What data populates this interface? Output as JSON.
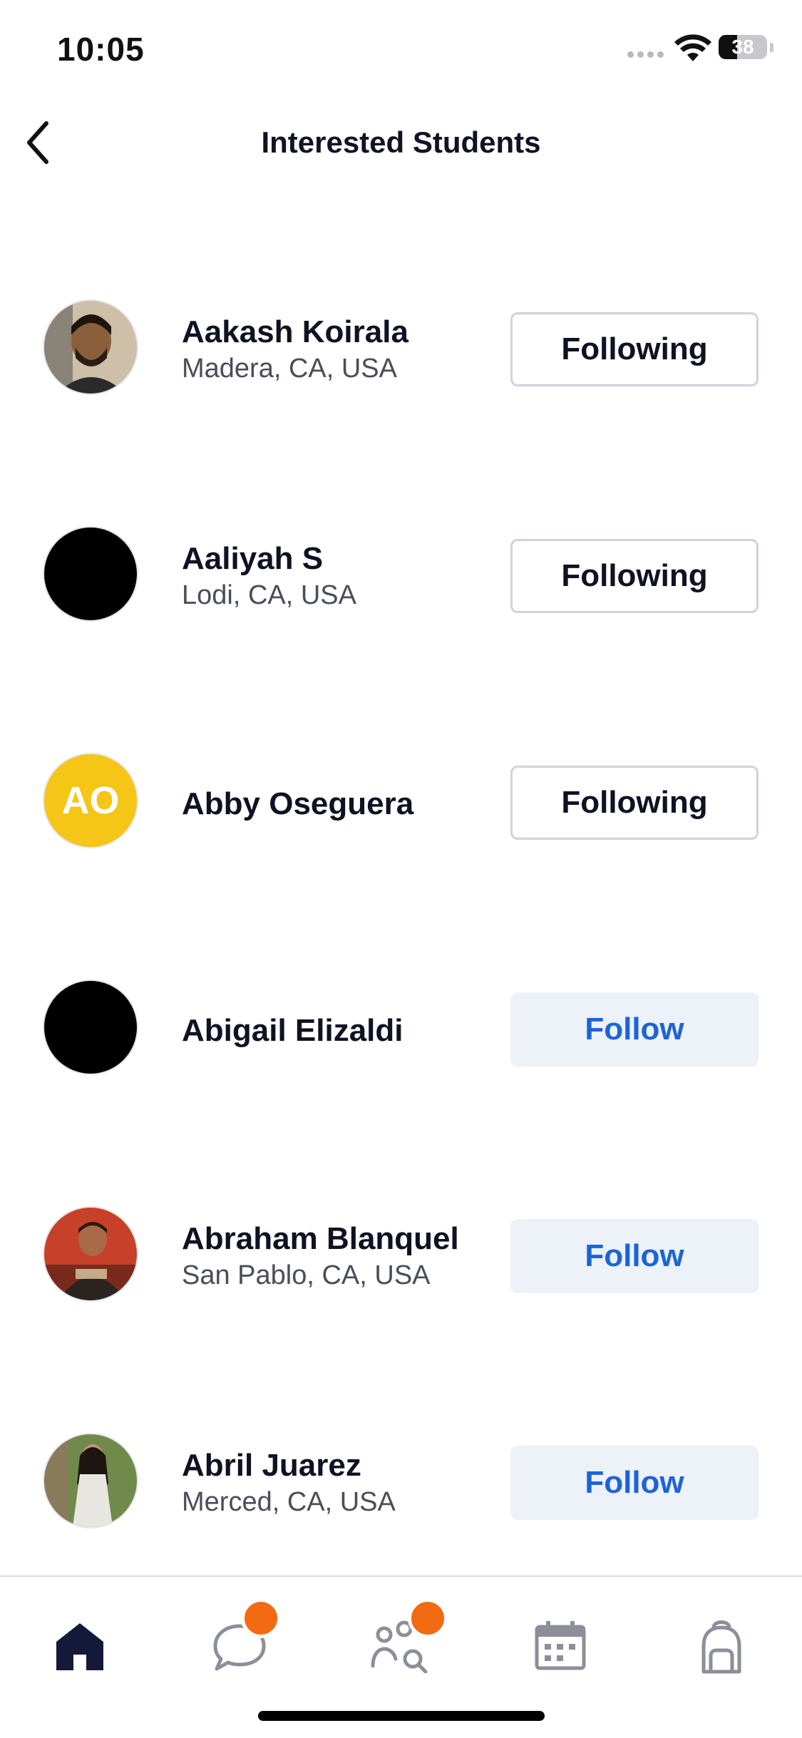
{
  "status_bar": {
    "time": "10:05",
    "battery_level": "38",
    "battery_fraction": 0.38
  },
  "header": {
    "title": "Interested Students"
  },
  "students": [
    {
      "name": "Aakash Koirala",
      "location": "Madera, CA, USA",
      "button_label": "Following",
      "state": "following",
      "avatar": "photo"
    },
    {
      "name": "Aaliyah S",
      "location": "Lodi, CA, USA",
      "button_label": "Following",
      "state": "following",
      "avatar": "black"
    },
    {
      "name": "Abby Oseguera",
      "location": "",
      "button_label": "Following",
      "state": "following",
      "avatar": "initials",
      "initials": "AO",
      "avatar_color": "#f5c518"
    },
    {
      "name": "Abigail Elizaldi",
      "location": "",
      "button_label": "Follow",
      "state": "follow",
      "avatar": "black"
    },
    {
      "name": "Abraham Blanquel",
      "location": "San Pablo, CA, USA",
      "button_label": "Follow",
      "state": "follow",
      "avatar": "photo"
    },
    {
      "name": "Abril Juarez",
      "location": "Merced, CA, USA",
      "button_label": "Follow",
      "state": "follow",
      "avatar": "photo"
    }
  ],
  "tab_bar": {
    "tabs": [
      {
        "icon": "home-icon",
        "active": true
      },
      {
        "icon": "chat-icon",
        "badge": true
      },
      {
        "icon": "people-search-icon",
        "badge": true
      },
      {
        "icon": "calendar-icon"
      },
      {
        "icon": "backpack-icon"
      }
    ]
  },
  "colors": {
    "accent_blue": "#1c64d6",
    "badge_orange": "#f26a12",
    "follow_bg": "#edf1f8",
    "text_dark": "#0f1222"
  }
}
